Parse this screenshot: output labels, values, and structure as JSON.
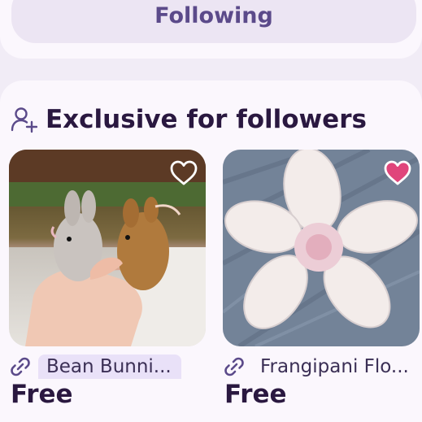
{
  "header": {
    "following_label": "Following"
  },
  "section": {
    "title": "Exclusive for followers",
    "icon": "add-user-icon"
  },
  "cards": [
    {
      "title": "Bean Bunni...",
      "price": "Free",
      "favorited": false,
      "link_icon": "link-icon",
      "image_subject": "two crocheted bunny plushies held in hand"
    },
    {
      "title": "Frangipani Flo...",
      "price": "Free",
      "favorited": true,
      "link_icon": "link-icon",
      "image_subject": "crocheted white frangipani flower on denim"
    }
  ],
  "colors": {
    "accent": "#5b4a8a",
    "favorite": "#e0457b",
    "title_highlight": "#e9e1f8"
  }
}
